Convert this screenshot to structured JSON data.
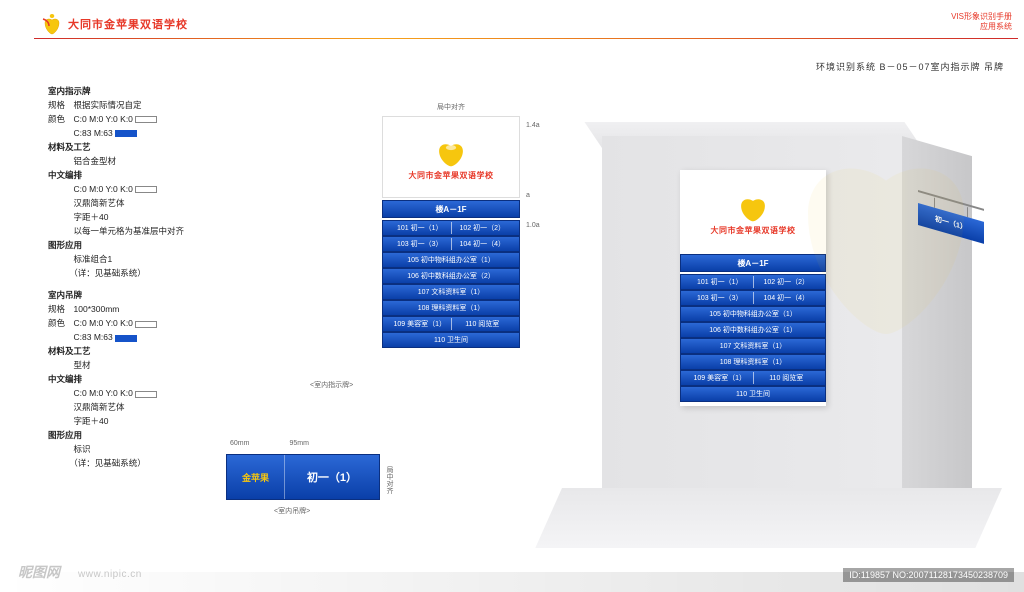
{
  "header": {
    "school_name": "大同市金苹果双语学校",
    "manual_line1": "VIS形象识别手册",
    "manual_line2": "应用系统",
    "section_title": "环境识别系统 B－05－07室内指示牌 吊牌"
  },
  "spec1": {
    "title": "室内指示牌",
    "spec_label": "规格",
    "spec_value": "根据实际情况自定",
    "color_label": "颜色",
    "cmyk1": "C:0 M:0 Y:0 K:0",
    "cmyk2": "C:83 M:63",
    "mat_label": "材料及工艺",
    "mat_value": "铝合金型材",
    "font_label": "中文编排",
    "font_cmyk": "C:0 M:0 Y:0 K:0",
    "font_name": "汉鼎简新艺体",
    "font_spacing": "字距＋40",
    "align_note": "以每一单元格为基准层中对齐",
    "app_label": "图形应用",
    "app_value": "标准组合1",
    "app_ref": "（详：见基础系统）"
  },
  "spec2": {
    "title": "室内吊牌",
    "spec_label": "规格",
    "spec_value": "100*300mm",
    "color_label": "颜色",
    "cmyk1": "C:0 M:0 Y:0 K:0",
    "cmyk2": "C:83 M:63",
    "mat_label": "材料及工艺",
    "mat_value": "型材",
    "font_label": "中文编排",
    "font_cmyk": "C:0 M:0 Y:0 K:0",
    "font_name": "汉鼎简新艺体",
    "font_spacing": "字距＋40",
    "app_label": "图形应用",
    "app_value": "标识",
    "app_ref": "（详：见基础系统）"
  },
  "sign": {
    "top_annot": "局中对齐",
    "right_annot1": "1.4a",
    "right_annot2": "a",
    "right_annot3": "1.0a",
    "left_annot": "<室内指示牌>",
    "school_name": "大同市金苹果双语学校",
    "floor_title": "楼A－1F",
    "rows": [
      {
        "left": "101 初一（1）",
        "right": "102 初一（2）"
      },
      {
        "left": "103 初一（3）",
        "right": "104 初一（4）"
      },
      {
        "single": "105 初中物科组办公室（1）"
      },
      {
        "single": "106 初中数科组办公室（2）"
      },
      {
        "single": "107 文科资料室（1）"
      },
      {
        "single": "108 理科资料室（1）"
      },
      {
        "left": "109 美容室（1）",
        "right": "110 阅览室"
      },
      {
        "single": "110 卫生间"
      }
    ]
  },
  "wall_sign": {
    "school_name": "大同市金苹果双语学校",
    "floor_title": "楼A－1F",
    "rows": [
      {
        "left": "101 初一（1）",
        "right": "102 初一（2）"
      },
      {
        "left": "103 初一（3）",
        "right": "104 初一（4）"
      },
      {
        "single": "105 初中物科组办公室（1）"
      },
      {
        "single": "106 初中数科组办公室（1）"
      },
      {
        "single": "107 文科资料室（1）"
      },
      {
        "single": "108 理科资料室（1）"
      },
      {
        "left": "109 美容室（1）",
        "right": "110 阅览室"
      },
      {
        "single": "110 卫生间"
      }
    ]
  },
  "plaque": {
    "dim_left": "60mm",
    "dim_right": "95mm",
    "apple_text": "金苹果",
    "text": "初一（1）",
    "annot_right": "局中对齐",
    "annot_below": "<室内吊牌>"
  },
  "hanging": {
    "text": "初一（1）"
  },
  "footer": {
    "brand": "昵图网",
    "url": "www.nipic.cn",
    "id": "ID:119857 NO:20071128173450238709"
  }
}
